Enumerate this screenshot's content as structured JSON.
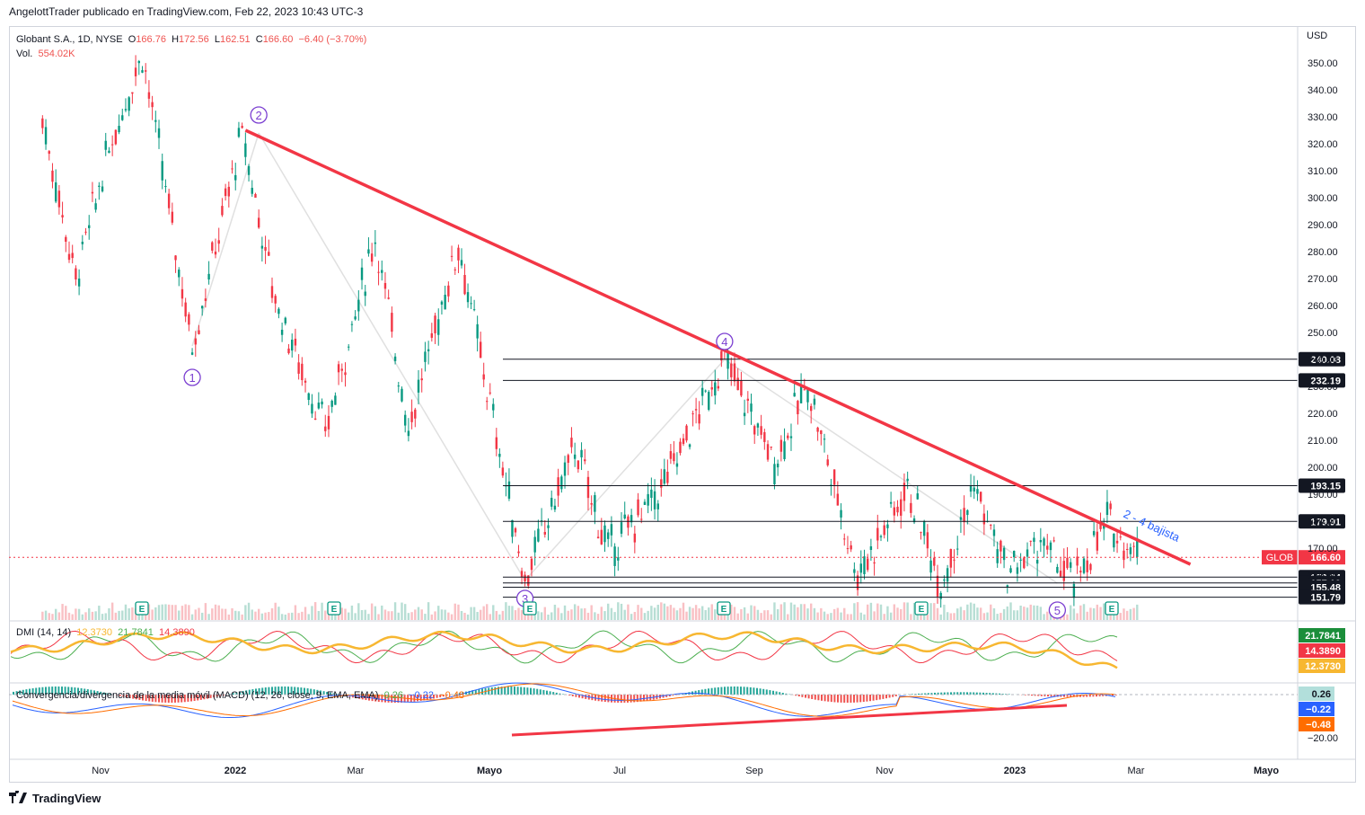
{
  "header": {
    "publisher_line": "AngelottTrader publicado en TradingView.com, Feb 22, 2023 10:43 UTC-3"
  },
  "legend": {
    "symbol": "Globant S.A., 1D, NYSE",
    "open_label": "O",
    "open": "166.76",
    "high_label": "H",
    "high": "172.56",
    "low_label": "L",
    "low": "162.51",
    "close_label": "C",
    "close": "166.60",
    "change": "−6.40 (−3.70%)",
    "vol_label": "Vol.",
    "vol": "554.02K"
  },
  "dmi_legend": {
    "title": "DMI (14, 14)",
    "adx": "12.3730",
    "plus_di": "21.7841",
    "minus_di": "14.3890"
  },
  "macd_legend": {
    "title": "Convergencia/divergencia de la media móvil (MACD) (12, 26, close, 9, EMA, EMA)",
    "hist": "0.26",
    "macd": "−0.22",
    "signal": "−0.48"
  },
  "footer": {
    "brand": "TradingView"
  },
  "colors": {
    "trendline": "#f23645",
    "up": "#089981",
    "down": "#f23645",
    "wave_label": "#7b3fd1",
    "annotation": "#2962ff"
  },
  "chart_data": {
    "type": "candlestick",
    "currency_label": "USD",
    "y_axis_ticks": [
      "350.00",
      "340.00",
      "330.00",
      "320.00",
      "310.00",
      "300.00",
      "290.00",
      "280.00",
      "270.00",
      "260.00",
      "250.00",
      "240.00",
      "230.00",
      "220.00",
      "210.00",
      "200.00",
      "190.00",
      "180.00",
      "170.00",
      "160.00"
    ],
    "x_axis_ticks": [
      "Nov",
      "2022",
      "Mar",
      "Mayo",
      "Jul",
      "Sep",
      "Nov",
      "2023",
      "Mar",
      "Mayo"
    ],
    "ylim": [
      150,
      356
    ],
    "price_path": [
      {
        "t": "Oct 2021",
        "v": 329
      },
      {
        "t": "Oct 2021",
        "v": 270
      },
      {
        "t": "Nov 2021",
        "v": 318
      },
      {
        "t": "Nov 2021",
        "v": 354
      },
      {
        "t": "Dec 2021",
        "v": 245
      },
      {
        "t": "Jan 2022",
        "v": 324
      },
      {
        "t": "Jan 2022",
        "v": 262
      },
      {
        "t": "Feb 2022",
        "v": 213
      },
      {
        "t": "Mar 2022",
        "v": 286
      },
      {
        "t": "Mar 2022",
        "v": 215
      },
      {
        "t": "Apr 2022",
        "v": 283
      },
      {
        "t": "May 2022",
        "v": 158
      },
      {
        "t": "Jun 2022",
        "v": 208
      },
      {
        "t": "Jun 2022",
        "v": 169
      },
      {
        "t": "Jul 2022",
        "v": 190
      },
      {
        "t": "Aug 2022",
        "v": 240
      },
      {
        "t": "Sep 2022",
        "v": 202
      },
      {
        "t": "Sep 2022",
        "v": 231
      },
      {
        "t": "Oct 2022",
        "v": 160
      },
      {
        "t": "Nov 2022",
        "v": 193
      },
      {
        "t": "Nov 2022",
        "v": 157
      },
      {
        "t": "Dec 2022",
        "v": 193
      },
      {
        "t": "Dec 2022",
        "v": 160
      },
      {
        "t": "Jan 2023",
        "v": 172
      },
      {
        "t": "Jan 2023",
        "v": 157
      },
      {
        "t": "Feb 2023",
        "v": 180
      },
      {
        "t": "Feb 2023",
        "v": 166.6
      }
    ],
    "wave_labels": [
      {
        "label": "1",
        "t": "Dec 2021",
        "v": 245
      },
      {
        "label": "2",
        "t": "Jan 2022",
        "v": 324
      },
      {
        "label": "3",
        "t": "May 2022",
        "v": 158
      },
      {
        "label": "4",
        "t": "Aug 2022",
        "v": 240
      },
      {
        "label": "5",
        "t": "Jan 2023",
        "v": 157
      }
    ],
    "trendline": {
      "from": {
        "t": "Jan 2022",
        "v": 325
      },
      "to": {
        "t": "Mar 2023",
        "v": 164
      }
    },
    "trendline_label": "2 - 4 bajista",
    "horizontal_levels": [
      {
        "price": "240.08"
      },
      {
        "price": "232.19"
      },
      {
        "price": "193.15"
      },
      {
        "price": "179.91"
      },
      {
        "price": "159.24"
      },
      {
        "price": "157.10"
      },
      {
        "price": "155.48"
      },
      {
        "price": "151.79"
      }
    ],
    "last_price": {
      "symbol": "GLOB",
      "price": "166.60"
    },
    "earnings_marker": "E",
    "volume_shown": true,
    "dmi_panel": {
      "adx": "12.3730",
      "plus_di": "21.7841",
      "minus_di": "14.3890"
    },
    "macd_panel": {
      "hist": "0.26",
      "macd": "−0.22",
      "signal": "−0.48",
      "ticks": [
        "−20.00"
      ]
    },
    "macd_divergence_line": true,
    "grid": false
  }
}
